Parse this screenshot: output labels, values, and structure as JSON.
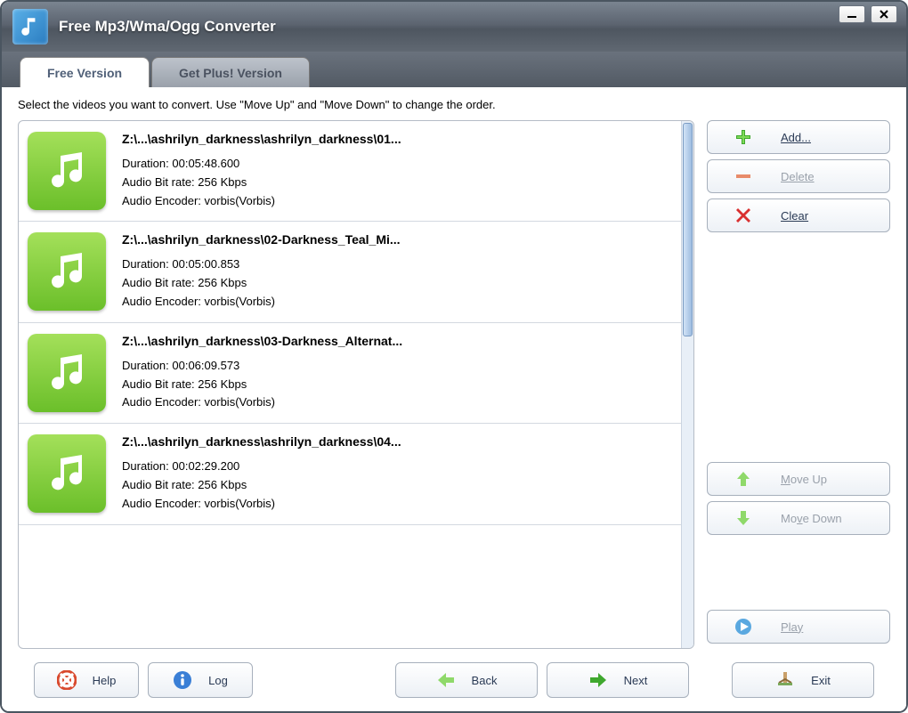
{
  "window": {
    "title": "Free Mp3/Wma/Ogg Converter"
  },
  "tabs": {
    "free": "Free Version",
    "plus": "Get Plus! Version"
  },
  "instruction": "Select the videos you want to convert. Use \"Move Up\" and \"Move Down\" to change the order.",
  "labels": {
    "duration": "Duration:",
    "bitrate": "Audio Bit rate:",
    "encoder": "Audio Encoder:"
  },
  "files": [
    {
      "path": "Z:\\...\\ashrilyn_darkness\\ashrilyn_darkness\\01...",
      "duration": "00:05:48.600",
      "bitrate": "256 Kbps",
      "encoder": "vorbis(Vorbis)"
    },
    {
      "path": "Z:\\...\\ashrilyn_darkness\\02-Darkness_Teal_Mi...",
      "duration": "00:05:00.853",
      "bitrate": "256 Kbps",
      "encoder": "vorbis(Vorbis)"
    },
    {
      "path": "Z:\\...\\ashrilyn_darkness\\03-Darkness_Alternat...",
      "duration": "00:06:09.573",
      "bitrate": "256 Kbps",
      "encoder": "vorbis(Vorbis)"
    },
    {
      "path": "Z:\\...\\ashrilyn_darkness\\ashrilyn_darkness\\04...",
      "duration": "00:02:29.200",
      "bitrate": "256 Kbps",
      "encoder": "vorbis(Vorbis)"
    }
  ],
  "buttons": {
    "add": "Add...",
    "delete": "Delete",
    "clear": "Clear",
    "moveup": "Move Up",
    "movedown": "Move Down",
    "play": "Play",
    "help": "Help",
    "log": "Log",
    "back": "Back",
    "next": "Next",
    "exit": "Exit"
  }
}
